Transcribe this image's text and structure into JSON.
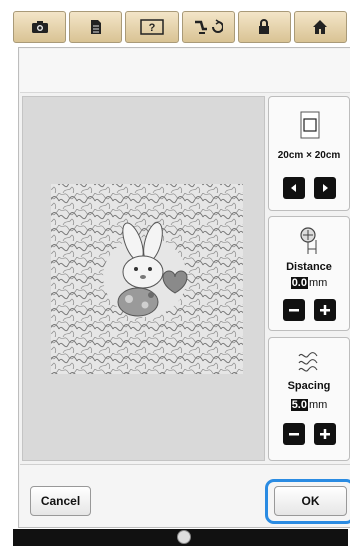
{
  "toolbar": {
    "buttons": [
      {
        "name": "camera-icon"
      },
      {
        "name": "document-icon"
      },
      {
        "name": "help-icon",
        "label": "[?]"
      },
      {
        "name": "stitch-sequence-icon"
      },
      {
        "name": "lock-icon"
      },
      {
        "name": "home-icon"
      }
    ]
  },
  "size_panel": {
    "dimensions": "20cm × 20cm"
  },
  "distance_panel": {
    "label": "Distance",
    "value": "0.0",
    "unit": "mm"
  },
  "spacing_panel": {
    "label": "Spacing",
    "value": "5.0",
    "unit": "mm"
  },
  "buttons": {
    "cancel": "Cancel",
    "ok": "OK"
  },
  "colors": {
    "toolbar": "#e5d2a8",
    "highlight": "#2a8be2",
    "button_dark": "#111111"
  }
}
